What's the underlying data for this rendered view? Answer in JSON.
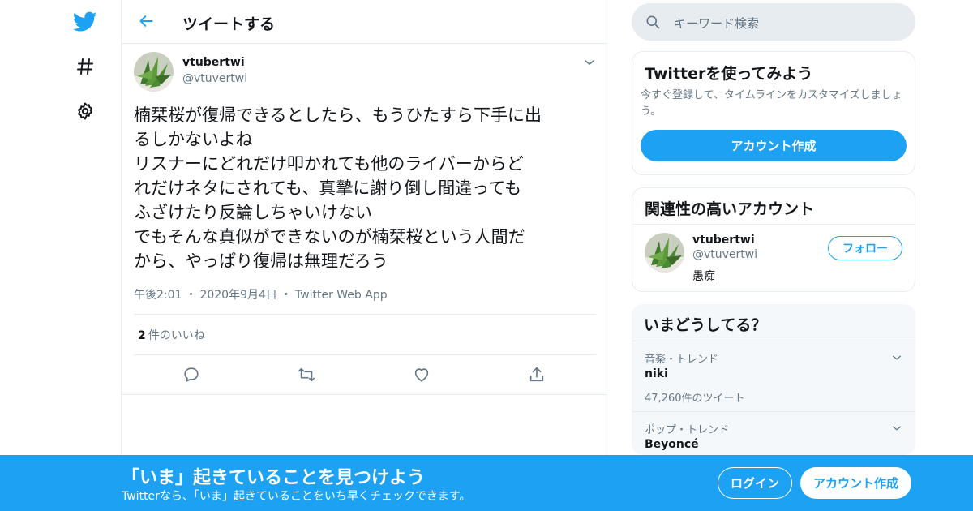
{
  "nav": {
    "icons": [
      "twitter-bird-icon",
      "hashtag-icon",
      "gear-icon"
    ]
  },
  "header": {
    "title": "ツイートする"
  },
  "tweet": {
    "author_name": "vtubertwi",
    "author_handle": "@vtuvertwi",
    "text": "楠栞桜が復帰できるとしたら、もうひたすら下手に出\nるしかないよね\nリスナーにどれだけ叩かれても他のライバーからど\nれだけネタにされても、真摯に謝り倒し間違っても\nふざけたり反論しちゃいけない\nでもそんな真似ができないのが楠栞桜という人間だ\nから、やっぱり復帰は無理だろう",
    "time": "午後2:01",
    "date": "2020年9月4日",
    "source": "Twitter Web App",
    "sep": "・",
    "like_count": "2",
    "like_label": "件のいいね"
  },
  "search": {
    "placeholder": "キーワード検索"
  },
  "signup_card": {
    "title": "Twitterを使ってみよう",
    "subtitle": "今すぐ登録して、タイムラインをカスタマイズしましょう。",
    "button": "アカウント作成"
  },
  "related_card": {
    "title": "関連性の高いアカウント",
    "name": "vtubertwi",
    "handle": "@vtuvertwi",
    "bio": "愚痴",
    "follow": "フォロー"
  },
  "trends_card": {
    "title": "いまどうしてる？",
    "items": [
      {
        "category": "音楽・トレンド",
        "name": "niki",
        "count": "47,260件のツイート"
      },
      {
        "category": "ポップ・トレンド",
        "name": "Beyoncé"
      }
    ]
  },
  "banner": {
    "title": "「いま」起きていることを見つけよう",
    "subtitle": "Twitterなら、「いま」起きていることをいち早くチェックできます。",
    "login": "ログイン",
    "create": "アカウント作成"
  },
  "colors": {
    "accent": "#1da1f2",
    "muted": "#657786",
    "border": "#e6ecf0"
  }
}
